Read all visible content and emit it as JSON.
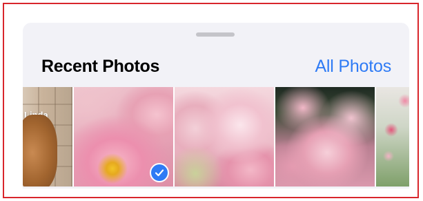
{
  "sheet": {
    "title": "Recent Photos",
    "all_photos_label": "All Photos"
  },
  "photos": [
    {
      "overlay_label": "Linda",
      "selected": false,
      "subject": "dog"
    },
    {
      "selected": true,
      "subject": "peony-closeup"
    },
    {
      "selected": false,
      "subject": "peonies"
    },
    {
      "selected": false,
      "subject": "peony-bouquet"
    },
    {
      "selected": false,
      "subject": "roses"
    }
  ],
  "colors": {
    "accent": "#2f7bf5",
    "frame_border": "#d8262b",
    "sheet_background": "#f2f2f7"
  },
  "icons": {
    "selected_badge": "checkmark-icon",
    "grabber": "grabber-handle"
  }
}
